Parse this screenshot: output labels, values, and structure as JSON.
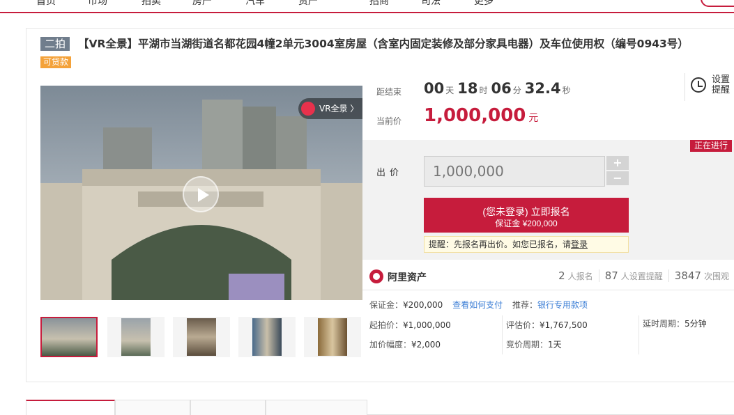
{
  "nav": {
    "items": [
      "首页",
      "市场",
      "拍卖",
      "房产",
      "汽车",
      "资产",
      "招商",
      "司法",
      "更多"
    ]
  },
  "auction": {
    "round_badge": "二拍",
    "title": "【VR全景】平湖市当湖街道名都花园4幢2单元3004室房屋（含室内固定装修及部分家具电器）及车位使用权（编号0943号）",
    "loan_tag": "可贷款",
    "vr_label": "VR全景 〉"
  },
  "countdown": {
    "label": "距结束",
    "days": "00",
    "days_unit": "天",
    "hours": "18",
    "hours_unit": "时",
    "minutes": "06",
    "minutes_unit": "分",
    "seconds": "32.4",
    "seconds_unit": "秒"
  },
  "current_price": {
    "label": "当前价",
    "value": "1,000,000",
    "unit": "元"
  },
  "reminder": {
    "label": "设置提醒"
  },
  "bid": {
    "status_tag": "正在进行",
    "label": "出价",
    "input_placeholder": "1,000,000",
    "plus": "+",
    "minus": "−",
    "signup_line1": "(您未登录) 立即报名",
    "signup_line2": "保证金 ¥200,000",
    "tip_prefix": "提醒：先报名再出价。如您已报名，请",
    "tip_link": "登录"
  },
  "platform": {
    "name": "阿里资产",
    "signups": "2",
    "signups_label": "人报名",
    "reminders": "87",
    "reminders_label": "人设置提醒",
    "views": "3847",
    "views_label": "次围观"
  },
  "details": {
    "deposit_label": "保证金：",
    "deposit_value": "¥200,000",
    "how_to_pay": "查看如何支付",
    "recommend_label": "推荐：",
    "recommend_link": "银行专用款项",
    "start_price_label": "起拍价：",
    "start_price_value": "¥1,000,000",
    "appraisal_label": "评估价：",
    "appraisal_value": "¥1,767,500",
    "delay_label": "延时周期：",
    "delay_value": "5分钟",
    "increment_label": "加价幅度：",
    "increment_value": "¥2,000",
    "cycle_label": "竞价周期：",
    "cycle_value": "1天"
  },
  "colors": {
    "brand_red": "#c61c3c",
    "loan_orange": "#f4a23a",
    "link_blue": "#3d7fd6",
    "badge_gray": "#707d8c"
  }
}
